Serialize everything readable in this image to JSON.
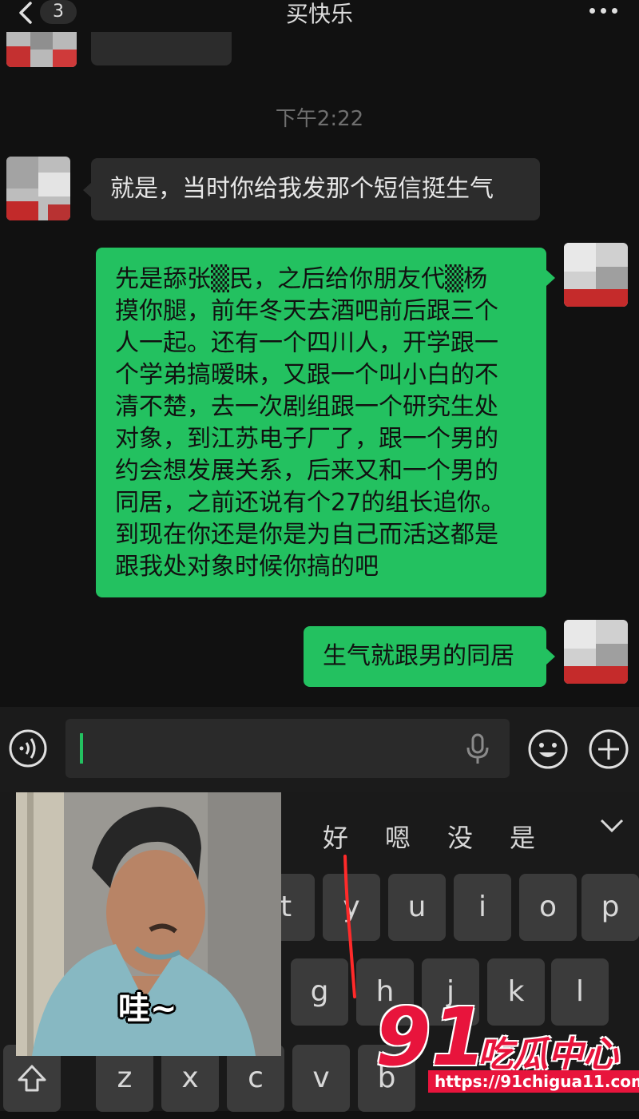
{
  "header": {
    "unread_count": "3",
    "title": "买快乐"
  },
  "time_divider": "下午2:22",
  "messages": [
    {
      "direction": "incoming",
      "text": "就是，当时你给我发那个短信挺生气"
    },
    {
      "direction": "outgoing",
      "lines": [
        "先是舔张▒民，之后给你朋友代▒杨",
        "摸你腿，前年冬天去酒吧前后跟三个",
        "人一起。还有一个四川人，开学跟一",
        "个学弟搞暧昧，又跟一个叫小白的不",
        "清不楚，去一次剧组跟一个研究生处",
        "对象，到江苏电子厂了，跟一个男的",
        "约会想发展关系，后来又和一个男的",
        "同居，之前还说有个27的组长追你。",
        "到现在你还是你是为自己而活这都是",
        "跟我处对象时候你搞的吧"
      ]
    },
    {
      "direction": "outgoing",
      "text": "生气就跟男的同居"
    }
  ],
  "keyboard": {
    "candidates": [
      "好",
      "嗯",
      "没",
      "是"
    ],
    "row1": [
      "t",
      "y",
      "u",
      "i",
      "o",
      "p"
    ],
    "row2": [
      "g",
      "h",
      "j",
      "k",
      "l"
    ],
    "row3": [
      "z",
      "x",
      "c",
      "v",
      "b"
    ]
  },
  "sticker": {
    "caption": "哇~"
  },
  "watermark": {
    "number": "91",
    "brand": "吃瓜中心",
    "url": "https://91chigua11.com"
  },
  "colors": {
    "outgoing_bubble": "#23c160",
    "incoming_bubble": "#2c2c2c",
    "background": "#111111",
    "watermark": "#e8143c"
  }
}
